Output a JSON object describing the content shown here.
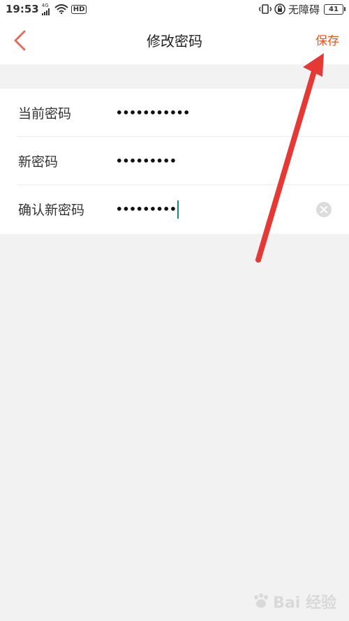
{
  "status_bar": {
    "time": "19:53",
    "network": "4G",
    "hd": "HD",
    "accessibility_label": "无障碍",
    "battery": "41"
  },
  "header": {
    "title": "修改密码",
    "save_label": "保存"
  },
  "form": {
    "rows": [
      {
        "label": "当前密码",
        "value": "•••••••••••"
      },
      {
        "label": "新密码",
        "value": "•••••••••"
      },
      {
        "label": "确认新密码",
        "value": "•••••••••"
      }
    ]
  },
  "colors": {
    "accent": "#e8531e",
    "back_icon": "#e86a5e",
    "annotation_arrow": "#e53935",
    "caret": "#138a7a"
  },
  "watermark": {
    "text": "Bai 经验"
  }
}
